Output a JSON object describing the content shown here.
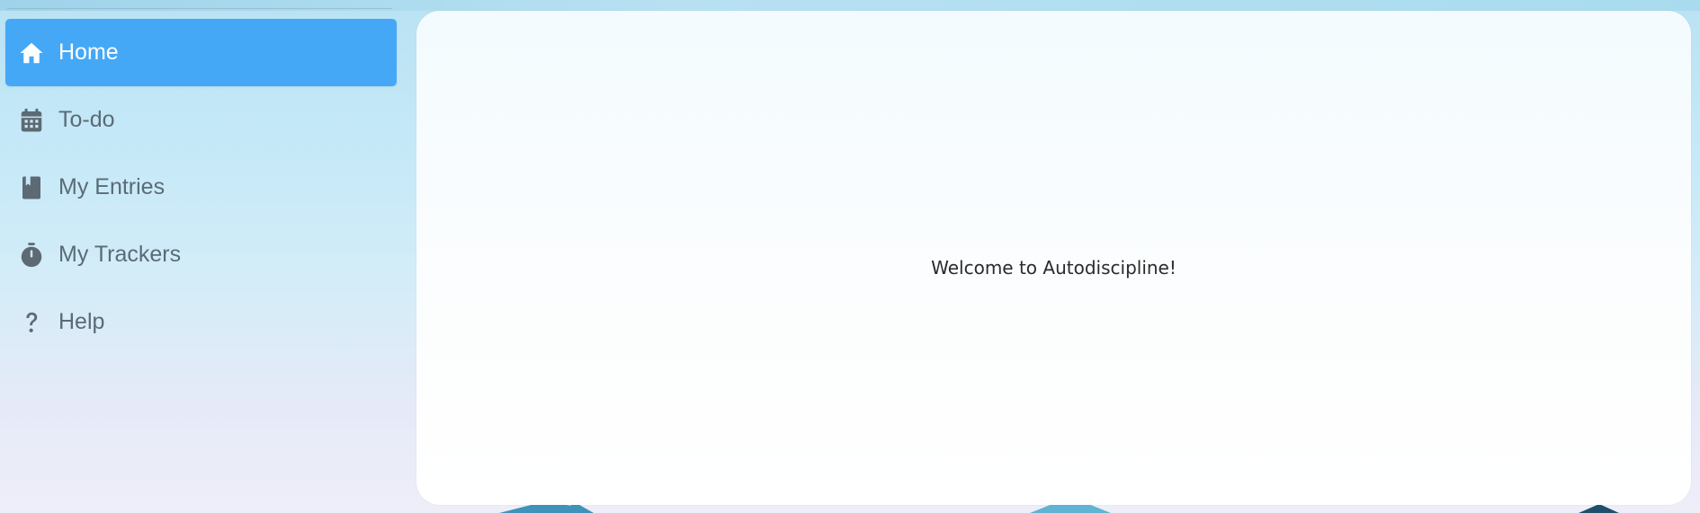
{
  "sidebar": {
    "items": [
      {
        "label": "Home",
        "icon": "home-icon",
        "active": true
      },
      {
        "label": "To-do",
        "icon": "calendar-icon",
        "active": false
      },
      {
        "label": "My Entries",
        "icon": "book-icon",
        "active": false
      },
      {
        "label": "My Trackers",
        "icon": "stopwatch-icon",
        "active": false
      },
      {
        "label": "Help",
        "icon": "help-icon",
        "active": false
      }
    ]
  },
  "main": {
    "welcome_text": "Welcome to Autodiscipline!"
  },
  "colors": {
    "accent": "#45a8f7",
    "nav_text": "#5a6b76",
    "icon": "#5d6a73",
    "panel_bg": "#ffffff"
  }
}
